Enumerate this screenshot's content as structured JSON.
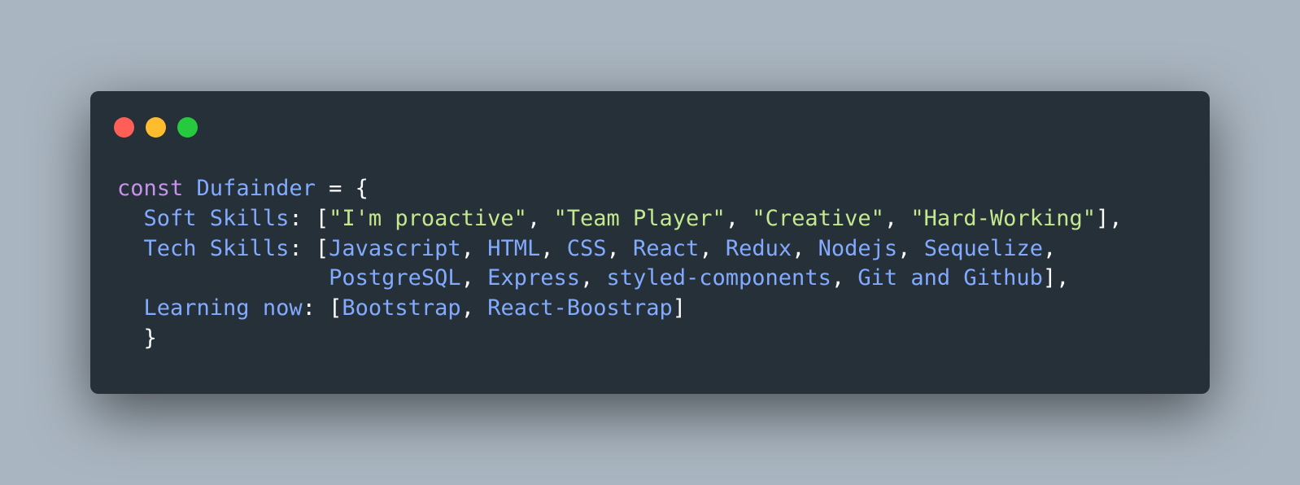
{
  "window": {
    "buttons": [
      {
        "name": "close",
        "color": "#ff5f56"
      },
      {
        "name": "minimize",
        "color": "#ffbd2e"
      },
      {
        "name": "maximize",
        "color": "#27c93f"
      }
    ]
  },
  "colors": {
    "keyword": "#c792ea",
    "identifier": "#82aaff",
    "string": "#c3e88d",
    "punctuation": "#ffffff"
  },
  "code": {
    "keyword": "const",
    "object_name": "Dufainder",
    "assign": " = {",
    "soft_skills": {
      "key": "Soft Skills",
      "items": [
        "\"I'm proactive\"",
        "\"Team Player\"",
        "\"Creative\"",
        "\"Hard-Working\""
      ]
    },
    "tech_skills": {
      "key": "Tech Skills",
      "items_line1": [
        "Javascript",
        "HTML",
        "CSS",
        "React",
        "Redux",
        "Nodejs",
        "Sequelize"
      ],
      "items_line2": [
        "PostgreSQL",
        "Express",
        "styled-components",
        "Git and Github"
      ]
    },
    "learning_now": {
      "key": "Learning now",
      "items": [
        "Bootstrap",
        "React-Boostrap"
      ]
    },
    "closing_brace": "}"
  }
}
